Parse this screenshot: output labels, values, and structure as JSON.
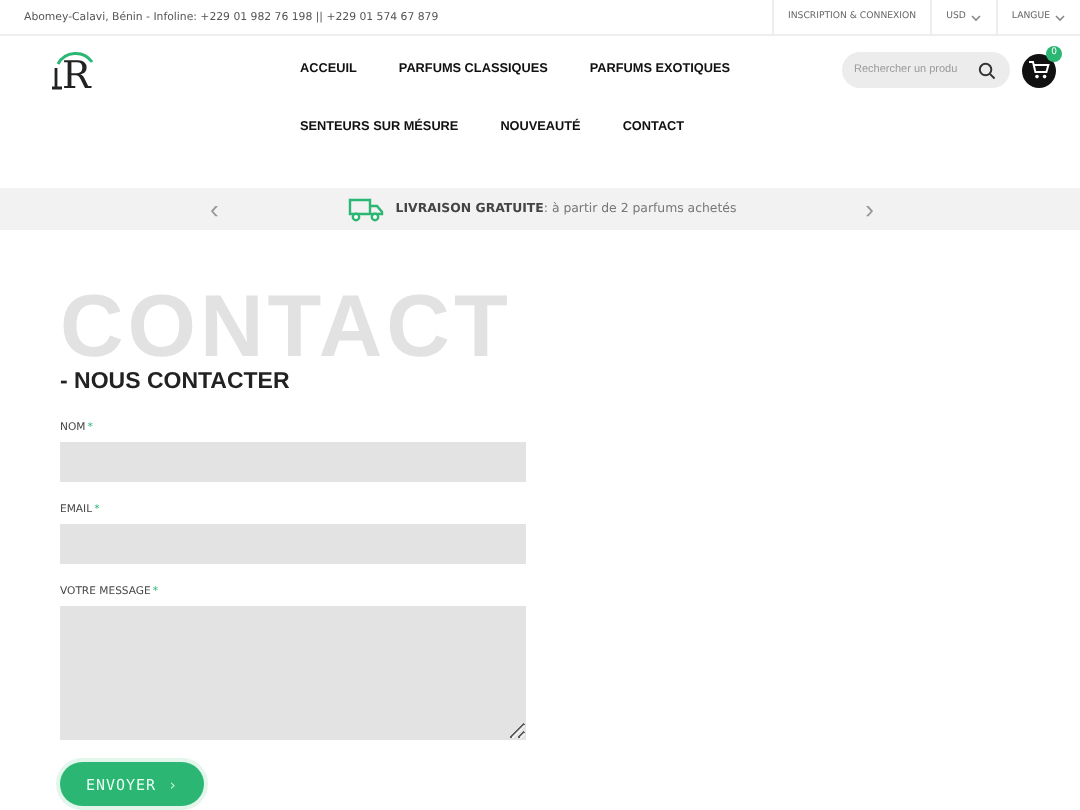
{
  "topbar": {
    "info": "Abomey-Calavi, Bénin - Infoline: +229 01 982 76 198 || +229 01 574 67 879",
    "links": [
      {
        "label": "INSCRIPTION & CONNEXION",
        "dropdown": false
      },
      {
        "label": "USD",
        "dropdown": true
      },
      {
        "label": "LANGUE",
        "dropdown": true
      }
    ]
  },
  "logo": {
    "text": "R"
  },
  "nav": {
    "rows": [
      [
        "ACCEUIL",
        "PARFUMS CLASSIQUES",
        "PARFUMS EXOTIQUES"
      ],
      [
        "SENTEURS SUR MÉSURE",
        "NOUVEAUTÉ",
        "CONTACT"
      ]
    ]
  },
  "search": {
    "placeholder": "Rechercher un produ"
  },
  "cart": {
    "count": "0"
  },
  "banner": {
    "text": "**LIVRAISON GRATUITE**: à partir de 2 parfums achetés",
    "prev": "‹",
    "next": "›"
  },
  "contact": {
    "backdrop": "CONTACT",
    "heading": "- NOUS CONTACTER",
    "fields": [
      {
        "label": "NOM",
        "kind": "input"
      },
      {
        "label": "EMAIL",
        "kind": "input"
      },
      {
        "label": "VOTRE MESSAGE",
        "kind": "textarea"
      }
    ],
    "required_mark": "*",
    "submit": "ENVOYER",
    "submit_arrow": "›"
  }
}
